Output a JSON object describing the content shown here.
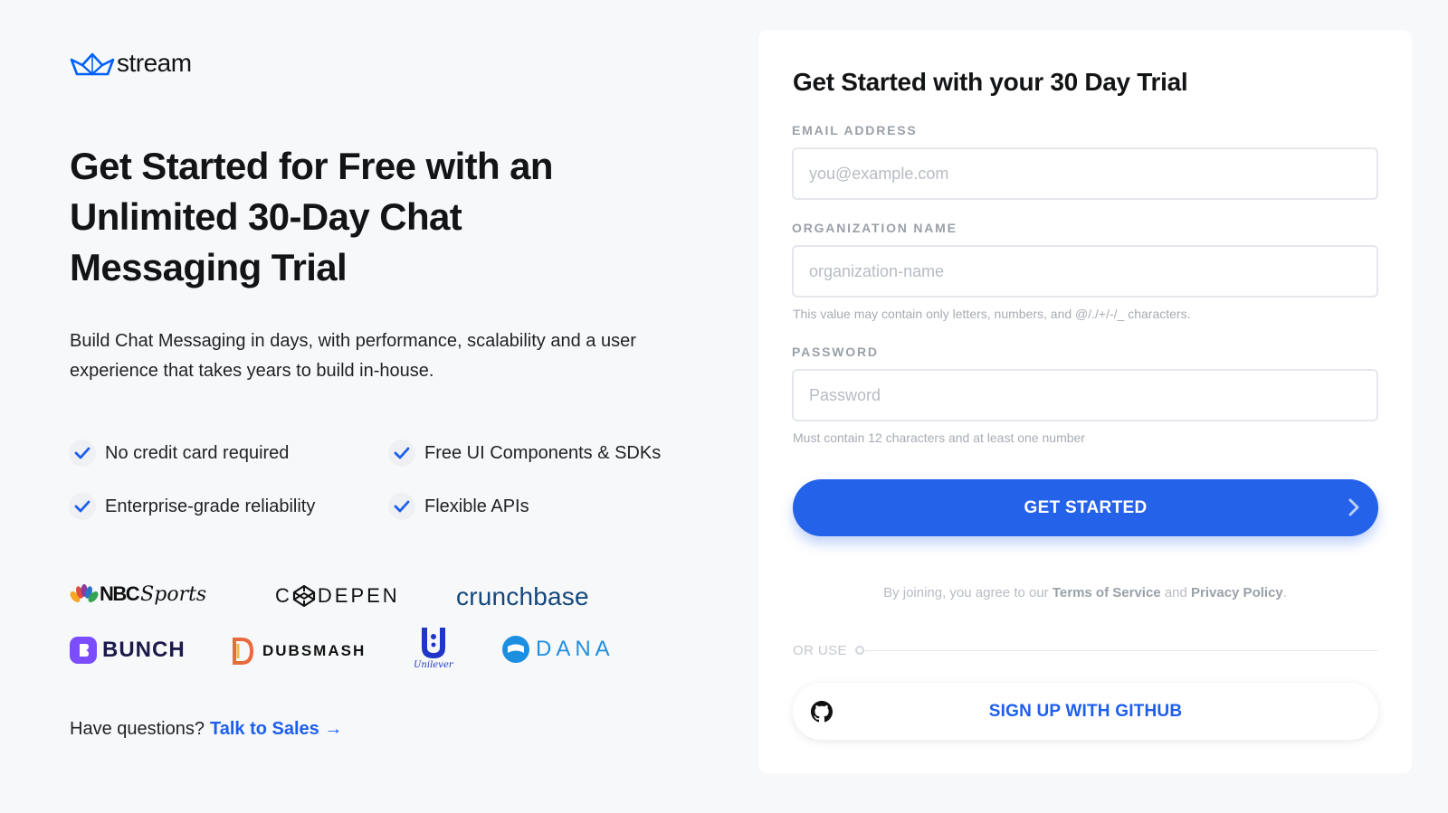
{
  "brand": {
    "name": "stream",
    "logo_icon": "boat-icon",
    "accent": "#005fff"
  },
  "hero": {
    "headline": "Get Started for Free with an Unlimited 30-Day Chat Messaging Trial",
    "subtext": "Build Chat Messaging in days, with performance, scalability and a user experience that takes years to build in-house."
  },
  "features": [
    {
      "label": "No credit card required",
      "icon": "check-icon"
    },
    {
      "label": "Free UI Components & SDKs",
      "icon": "check-icon"
    },
    {
      "label": "Enterprise-grade reliability",
      "icon": "check-icon"
    },
    {
      "label": "Flexible APIs",
      "icon": "check-icon"
    }
  ],
  "customers": {
    "nbc": {
      "main": "NBC",
      "script": "Sports"
    },
    "codepen": {
      "left": "C",
      "right": "DEPEN"
    },
    "crunchbase": "crunchbase",
    "bunch": "BUNCH",
    "dubsmash": "DUBSMASH",
    "unilever": "Unilever",
    "dana": "DANA"
  },
  "questions": {
    "text": "Have questions?",
    "link": "Talk to Sales →"
  },
  "form": {
    "title": "Get Started with your 30 Day Trial",
    "email": {
      "label": "EMAIL ADDRESS",
      "placeholder": "you@example.com",
      "value": ""
    },
    "organization": {
      "label": "ORGANIZATION NAME",
      "placeholder": "organization-name",
      "value": "",
      "hint": "This value may contain only letters, numbers, and @/./+/-/_ characters."
    },
    "password": {
      "label": "PASSWORD",
      "placeholder": "Password",
      "value": "",
      "hint": "Must contain 12 characters and at least one number"
    },
    "submit_label": "GET STARTED",
    "terms": {
      "prefix": "By joining, you agree to our",
      "tos": "Terms of Service",
      "and": "and",
      "privacy": "Privacy Policy",
      "suffix": "."
    },
    "or_use": "OR USE",
    "github_label": "SIGN UP WITH GITHUB"
  },
  "colors": {
    "primary_button": "#2562ea",
    "link": "#1d5ef0",
    "background": "#f7f8f9"
  }
}
